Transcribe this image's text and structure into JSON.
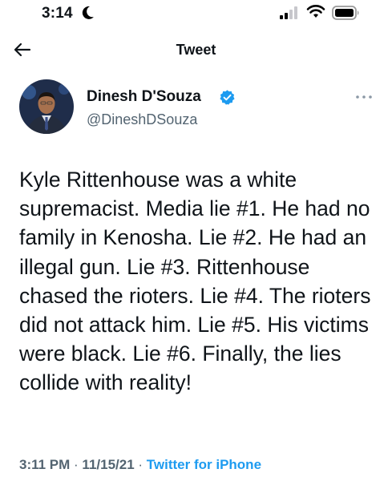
{
  "status_bar": {
    "time": "3:14",
    "dnd_icon": "moon-icon",
    "signal_icon": "cellular-signal-icon",
    "wifi_icon": "wifi-icon",
    "battery_icon": "battery-icon"
  },
  "header": {
    "back_icon": "back-arrow-icon",
    "title": "Tweet"
  },
  "author": {
    "name": "Dinesh D'Souza",
    "handle": "@DineshDSouza",
    "verified_icon": "verified-badge-icon",
    "more_icon": "more-options-icon"
  },
  "tweet": {
    "text": "Kyle Rittenhouse was a white supremacist. Media lie #1. He had no family in Kenosha. Lie #2. He had an illegal gun. Lie #3. Rittenhouse chased the rioters. Lie #4. The rioters did not attack him. Lie #5. His victims were black. Lie #6. Finally, the lies collide with reality!"
  },
  "meta": {
    "time": "3:11 PM",
    "sep1": " · ",
    "date": "11/15/21",
    "sep2": " · ",
    "source": "Twitter for iPhone"
  },
  "colors": {
    "text": "#0f1419",
    "secondary": "#536471",
    "accent": "#1d9bf0"
  }
}
